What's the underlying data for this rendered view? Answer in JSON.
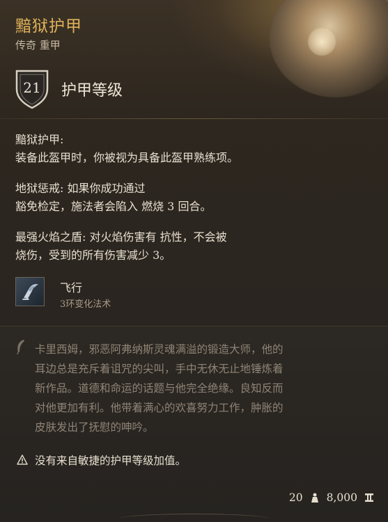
{
  "item": {
    "name": "黯狱护甲",
    "subtype": "传奇 重甲",
    "armor_class_value": "21",
    "armor_class_label": "护甲等级"
  },
  "properties": [
    {
      "line1": "黯狱护甲:",
      "line2": "装备此盔甲时，你被视为具备此盔甲熟练项。"
    },
    {
      "line1": "地狱惩戒: 如果你成功通过",
      "line2": "豁免检定，施法者会陷入 燃烧 3 回合。"
    },
    {
      "line1": "最强火焰之盾: 对火焰伤害有 抗性，不会被",
      "line2": "烧伤，受到的所有伤害减少 3。"
    }
  ],
  "spell": {
    "name": "飞行",
    "subtitle": "3环变化法术",
    "icon": "winged-boot-icon"
  },
  "lore": [
    "卡里西姆，邪恶阿弗纳斯灵魂满溢的锻造大师，他的",
    "耳边总是充斥着诅咒的尖叫，手中无休无止地锤炼着",
    "新作品。道德和命运的话题与他完全绝缘。良知反而",
    "对他更加有利。他带着满心的欢喜努力工作，肿胀的",
    "皮肤发出了抚慰的呻吟。"
  ],
  "warning": "没有来自敏捷的护甲等级加值。",
  "footer": {
    "weight": "20",
    "weight_icon": "weight-icon",
    "price": "8,000",
    "price_icon": "gold-coin-icon"
  },
  "colors": {
    "name_gold": "#e0b25a",
    "text": "#e8dfd0",
    "lore_text": "#8f8476"
  }
}
